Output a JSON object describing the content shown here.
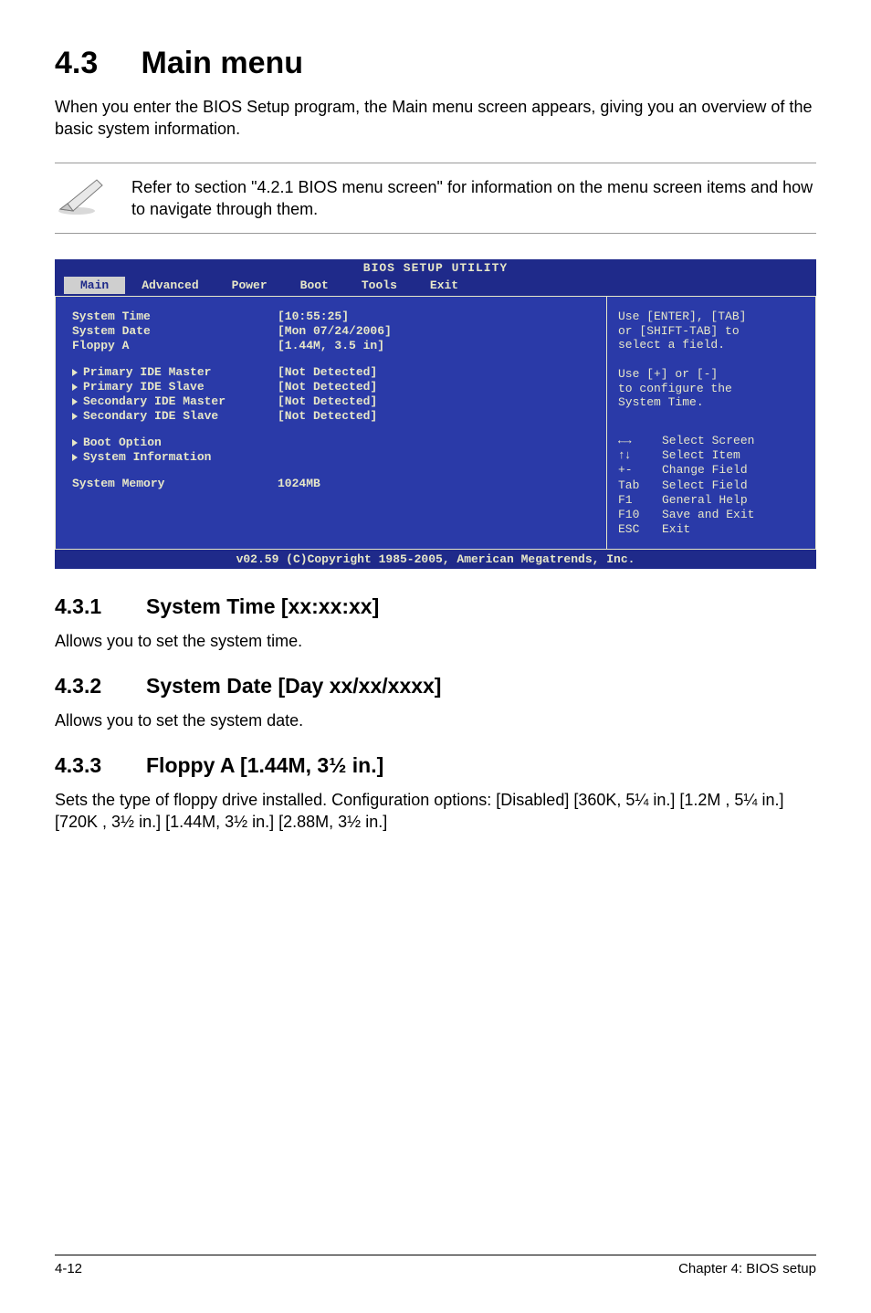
{
  "section_number": "4.3",
  "section_title": "Main menu",
  "intro": "When you enter the BIOS Setup program, the Main menu screen appears, giving you an overview of the basic system information.",
  "note": "Refer to section \"4.2.1  BIOS menu screen\" for information on the menu screen items and how to navigate through them.",
  "bios": {
    "titlebar": "BIOS SETUP UTILITY",
    "menu": [
      "Main",
      "Advanced",
      "Power",
      "Boot",
      "Tools",
      "Exit"
    ],
    "selected_menu": "Main",
    "fields_top": [
      {
        "label": "System Time",
        "value": "[10:55:25]"
      },
      {
        "label": "System Date",
        "value": "[Mon 07/24/2006]"
      },
      {
        "label": "Floppy A",
        "value": "[1.44M, 3.5 in]"
      }
    ],
    "fields_ide": [
      {
        "label": "Primary IDE Master",
        "value": "[Not Detected]"
      },
      {
        "label": "Primary IDE Slave",
        "value": "[Not Detected]"
      },
      {
        "label": "Secondary IDE Master",
        "value": "[Not Detected]"
      },
      {
        "label": "Secondary IDE Slave",
        "value": "[Not Detected]"
      }
    ],
    "fields_sub": [
      {
        "label": "Boot Option"
      },
      {
        "label": "System Information"
      }
    ],
    "memory_label": "System Memory",
    "memory_value": "1024MB",
    "help_top_1": "Use [ENTER], [TAB]",
    "help_top_2": "or [SHIFT-TAB] to",
    "help_top_3": "select a field.",
    "help_mid_1": "Use [+] or [-]",
    "help_mid_2": "to configure the",
    "help_mid_3": "System Time.",
    "nav": {
      "lr_label": "Select Screen",
      "ud_label": "Select Item",
      "pm_key": "+-",
      "pm_label": "Change Field",
      "tab_key": "Tab",
      "tab_label": "Select Field",
      "f1_key": "F1",
      "f1_label": "General Help",
      "f10_key": "F10",
      "f10_label": "Save and Exit",
      "esc_key": "ESC",
      "esc_label": "Exit"
    },
    "footer": "v02.59 (C)Copyright 1985-2005, American Megatrends, Inc."
  },
  "sub431_num": "4.3.1",
  "sub431_title": "System Time [xx:xx:xx]",
  "sub431_body": "Allows you to set the system time.",
  "sub432_num": "4.3.2",
  "sub432_title": "System Date [Day xx/xx/xxxx]",
  "sub432_body": "Allows you to set the system date.",
  "sub433_num": "4.3.3",
  "sub433_title": "Floppy A [1.44M, 3½ in.]",
  "sub433_body": "Sets the type of floppy drive installed. Configuration options: [Disabled] [360K, 5¼ in.] [1.2M , 5¼ in.] [720K , 3½ in.] [1.44M, 3½ in.] [2.88M, 3½ in.]",
  "footer_left": "4-12",
  "footer_right": "Chapter 4: BIOS setup"
}
